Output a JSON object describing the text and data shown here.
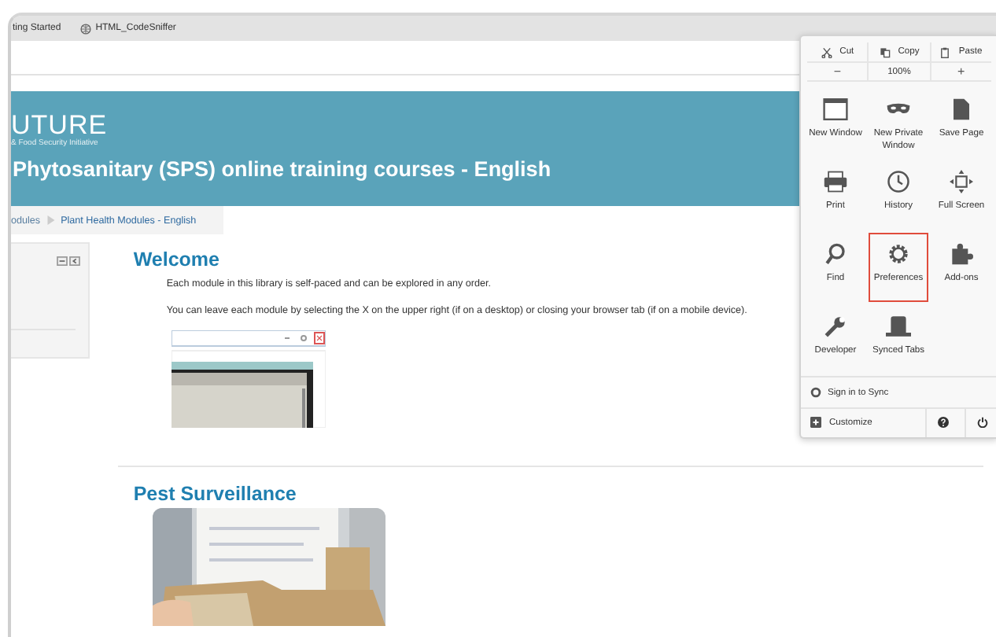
{
  "bookmarks": [
    {
      "label": "ting Started",
      "kind": "text"
    },
    {
      "label": "HTML_CodeSniffer",
      "kind": "globe"
    }
  ],
  "banner": {
    "logo": "UTURE",
    "tagline": "& Food Security Initiative",
    "title": "Phytosanitary (SPS) online training courses - English"
  },
  "breadcrumb": [
    "odules",
    "Plant Health Modules - English"
  ],
  "welcome": {
    "heading": "Welcome",
    "paragraphs": [
      "Each module in this library is self-paced and can be explored in any order.",
      "You can leave each module by selecting the X on the upper right (if on a desktop) or closing your browser tab (if on a mobile device)."
    ]
  },
  "pest": {
    "heading": "Pest Surveillance"
  },
  "menu": {
    "edit": [
      {
        "label": "Cut",
        "kind": "cut"
      },
      {
        "label": "Copy",
        "kind": "copy"
      },
      {
        "label": "Paste",
        "kind": "paste"
      }
    ],
    "zoom": {
      "minus": "−",
      "level": "100%",
      "plus": "+"
    },
    "items": [
      {
        "label": "New Window",
        "kind": "window",
        "selected": false
      },
      {
        "label": "New Private Window",
        "kind": "mask",
        "selected": false
      },
      {
        "label": "Save Page",
        "kind": "page",
        "selected": false
      },
      {
        "label": "Print",
        "kind": "print",
        "selected": false
      },
      {
        "label": "History",
        "kind": "clock",
        "selected": false
      },
      {
        "label": "Full Screen",
        "kind": "fullscreen",
        "selected": false
      },
      {
        "label": "Find",
        "kind": "find",
        "selected": false
      },
      {
        "label": "Preferences",
        "kind": "gear",
        "selected": true
      },
      {
        "label": "Add-ons",
        "kind": "puzzle",
        "selected": false
      },
      {
        "label": "Developer",
        "kind": "wrench",
        "selected": false
      },
      {
        "label": "Synced Tabs",
        "kind": "tabs",
        "selected": false
      }
    ],
    "sync": "Sign in to Sync",
    "customize": "Customize"
  }
}
